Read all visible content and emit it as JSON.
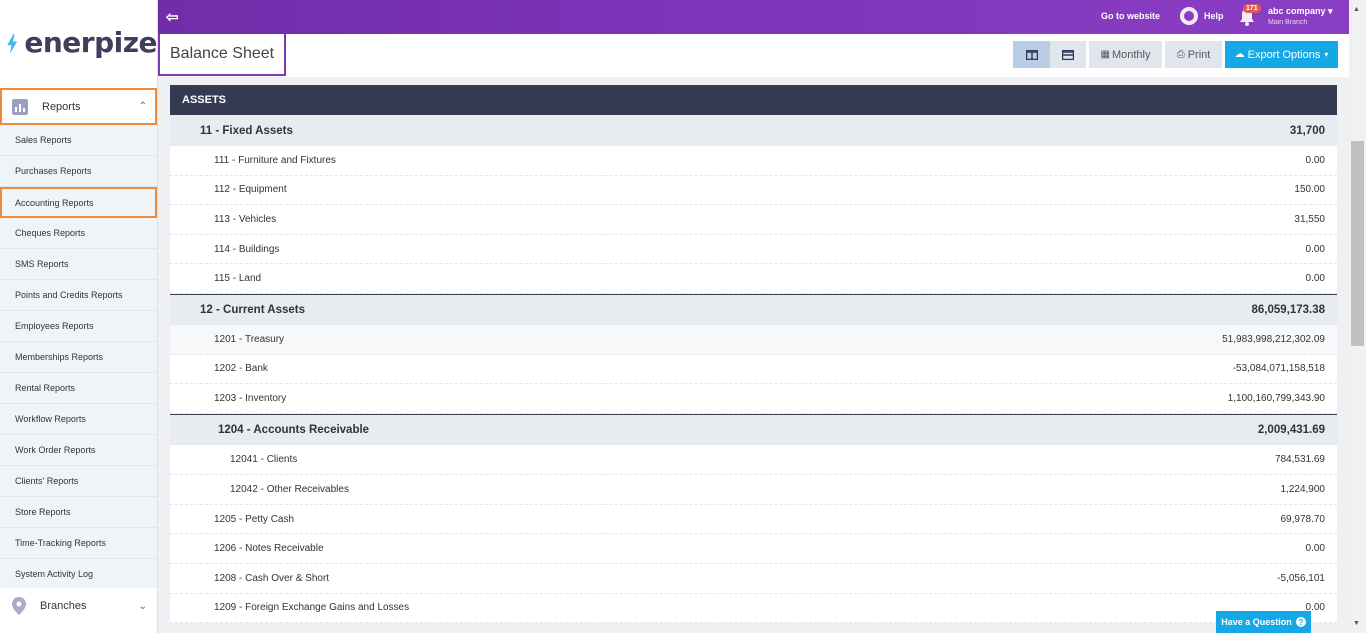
{
  "brand": {
    "name": "enerpize",
    "accent": "#7b3bb2",
    "highlight": "#ef8a3c",
    "primary": "#14a8e6"
  },
  "topbar": {
    "collapse_icon": "arrow-left-bars",
    "go_to_website": "Go to website",
    "help": "Help",
    "notification_count": "171",
    "company": "abc company",
    "branch": "Main Branch"
  },
  "sidebar": {
    "parent": {
      "label": "Reports",
      "icon": "bar-chart-icon",
      "expanded": true
    },
    "items": [
      {
        "label": "Sales Reports"
      },
      {
        "label": "Purchases Reports"
      },
      {
        "label": "Accounting Reports",
        "active": true
      },
      {
        "label": "Cheques Reports"
      },
      {
        "label": "SMS Reports"
      },
      {
        "label": "Points and Credits Reports"
      },
      {
        "label": "Employees Reports"
      },
      {
        "label": "Memberships Reports"
      },
      {
        "label": "Rental Reports"
      },
      {
        "label": "Workflow Reports"
      },
      {
        "label": "Work Order Reports"
      },
      {
        "label": "Clients' Reports"
      },
      {
        "label": "Store Reports"
      },
      {
        "label": "Time-Tracking Reports"
      },
      {
        "label": "System Activity Log"
      }
    ],
    "branches": {
      "label": "Branches",
      "icon": "map-pin-icon"
    }
  },
  "page": {
    "title": "Balance Sheet",
    "toolbar": {
      "monthly": "Monthly",
      "print": "Print",
      "export": "Export Options"
    }
  },
  "report": {
    "section": "ASSETS",
    "rows": [
      {
        "type": "group",
        "label": "11 - Fixed Assets",
        "value": "31,700"
      },
      {
        "type": "item",
        "label": "111 - Furniture and Fixtures",
        "value": "0.00"
      },
      {
        "type": "item",
        "label": "112 - Equipment",
        "value": "150.00"
      },
      {
        "type": "item",
        "label": "113 - Vehicles",
        "value": "31,550"
      },
      {
        "type": "item",
        "label": "114 - Buildings",
        "value": "0.00"
      },
      {
        "type": "item",
        "label": "115 - Land",
        "value": "0.00"
      },
      {
        "type": "group",
        "label": "12 - Current Assets",
        "value": "86,059,173.38"
      },
      {
        "type": "item",
        "label": "1201 - Treasury",
        "value": "51,983,998,212,302.09"
      },
      {
        "type": "item",
        "label": "1202 - Bank",
        "value": "-53,084,071,158,518"
      },
      {
        "type": "item",
        "label": "1203 - Inventory",
        "value": "1,100,160,799,343.90"
      },
      {
        "type": "group",
        "label": "1204 - Accounts Receivable",
        "value": "2,009,431.69"
      },
      {
        "type": "subitem",
        "label": "12041 - Clients",
        "value": "784,531.69"
      },
      {
        "type": "subitem",
        "label": "12042 - Other Receivables",
        "value": "1,224,900"
      },
      {
        "type": "item",
        "label": "1205 - Petty Cash",
        "value": "69,978.70"
      },
      {
        "type": "item",
        "label": "1206 - Notes Receivable",
        "value": "0.00"
      },
      {
        "type": "item",
        "label": "1208 - Cash Over & Short",
        "value": "-5,056,101"
      },
      {
        "type": "item",
        "label": "1209 - Foreign Exchange Gains and Losses",
        "value": "0.00"
      }
    ]
  },
  "help_widget": {
    "label": "Have a Question"
  }
}
